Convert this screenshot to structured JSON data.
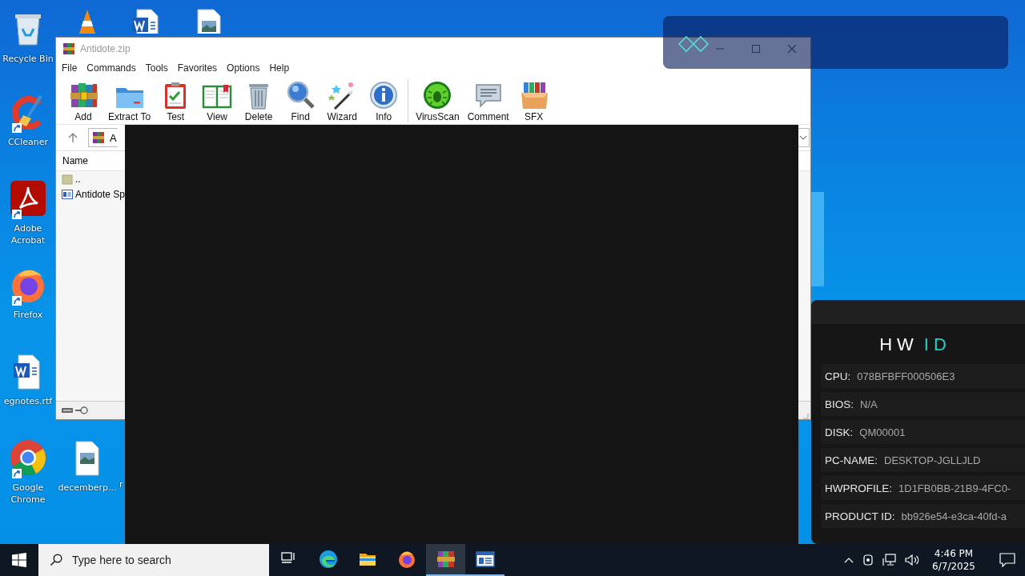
{
  "desktop": {
    "icons": [
      {
        "kind": "recycle",
        "label": "Recycle Bin"
      },
      {
        "kind": "cone"
      },
      {
        "kind": "word"
      },
      {
        "kind": "image"
      },
      {
        "kind": "ccleaner",
        "label": "CCleaner",
        "shortcut": true
      },
      {
        "kind": "acrobat",
        "label": "Adobe Acrobat",
        "shortcut": true
      },
      {
        "kind": "firefox",
        "label": "Firefox",
        "shortcut": true
      },
      {
        "kind": "word",
        "label": "egnotes.rtf"
      },
      {
        "kind": "chrome",
        "label": "Google Chrome",
        "shortcut": true
      },
      {
        "kind": "image",
        "label": "decemberp..."
      },
      {
        "kind": "none",
        "label": "r"
      }
    ]
  },
  "archiver": {
    "title": "Antidote.zip",
    "menu": [
      "File",
      "Commands",
      "Tools",
      "Favorites",
      "Options",
      "Help"
    ],
    "toolbar_groups": [
      [
        {
          "kind": "add",
          "label": "Add"
        },
        {
          "kind": "extract",
          "label": "Extract To"
        },
        {
          "kind": "test",
          "label": "Test"
        },
        {
          "kind": "view",
          "label": "View"
        },
        {
          "kind": "delete",
          "label": "Delete"
        },
        {
          "kind": "find",
          "label": "Find"
        },
        {
          "kind": "wizard",
          "label": "Wizard"
        },
        {
          "kind": "info",
          "label": "Info"
        }
      ],
      [
        {
          "kind": "virus",
          "label": "VirusScan"
        },
        {
          "kind": "comment",
          "label": "Comment"
        },
        {
          "kind": "sfx",
          "label": "SFX"
        }
      ]
    ],
    "address": "A",
    "columns": [
      "Name"
    ],
    "rows": [
      {
        "kind": "folder",
        "name": ".."
      },
      {
        "kind": "file",
        "name": "Antidote Sp"
      }
    ]
  },
  "hwid_panel": {
    "title": [
      {
        "text": "HW",
        "color": "#ffffff"
      },
      {
        "text": "ID",
        "color": "#22d3c5"
      }
    ],
    "rows": [
      {
        "label": "CPU:",
        "value": "078BFBFF000506E3"
      },
      {
        "label": "BIOS:",
        "value": "N/A"
      },
      {
        "label": "DISK:",
        "value": "QM00001"
      },
      {
        "label": "PC-NAME:",
        "value": "DESKTOP-JGLLJLD"
      },
      {
        "label": "HWPROFILE:",
        "value": "1D1FB0BB-21B9-4FC0-"
      },
      {
        "label": "PRODUCT ID:",
        "value": "bb926e54-e3ca-40fd-a"
      }
    ]
  },
  "taskbar": {
    "search": {
      "placeholder": "Type here to search"
    },
    "apps": [
      {
        "kind": "taskview",
        "running": false,
        "selected": false
      },
      {
        "kind": "edge",
        "running": false,
        "selected": false
      },
      {
        "kind": "explorer",
        "running": false,
        "selected": false
      },
      {
        "kind": "firefox",
        "running": false,
        "selected": false
      },
      {
        "kind": "archiver",
        "running": true,
        "selected": true
      },
      {
        "kind": "window",
        "running": true,
        "selected": false
      }
    ],
    "time": "4:46 PM",
    "date": "6/7/2025"
  }
}
